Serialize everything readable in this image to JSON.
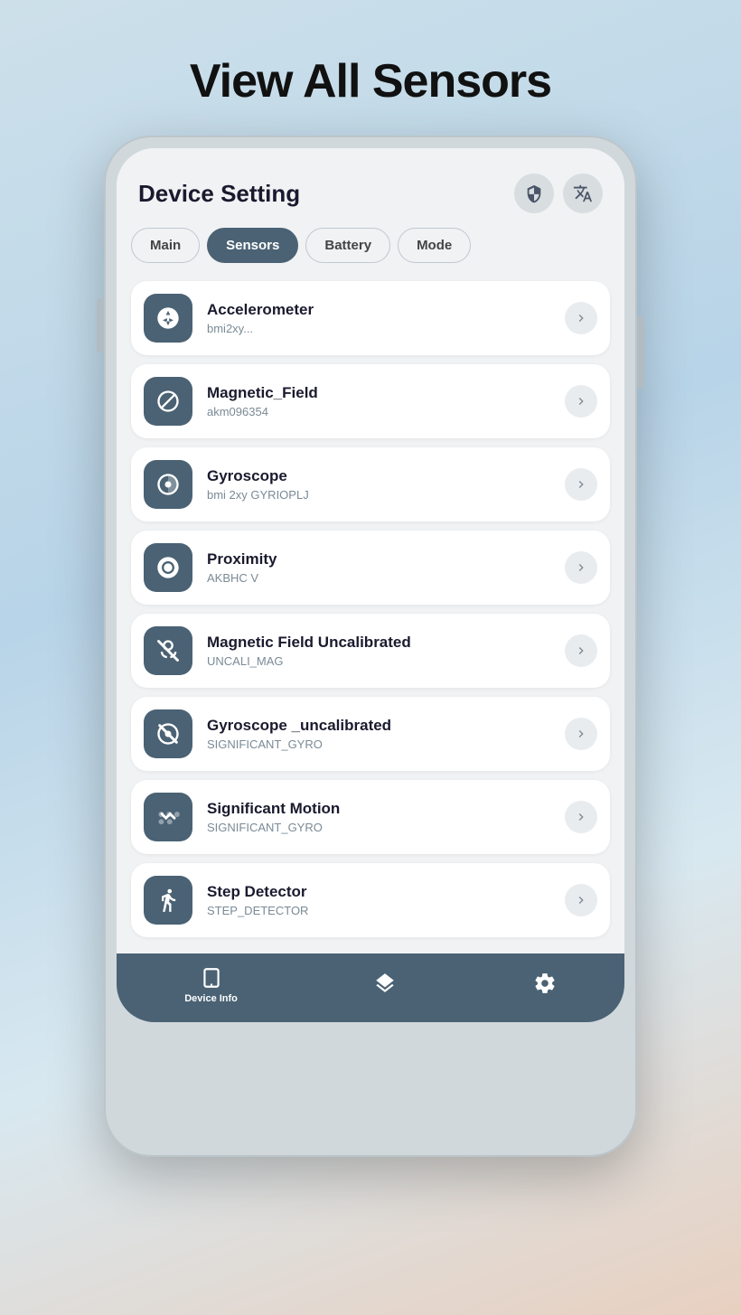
{
  "page": {
    "title": "View All Sensors"
  },
  "app": {
    "header_title": "Device Setting",
    "tabs": [
      {
        "label": "Main",
        "active": false
      },
      {
        "label": "Sensors",
        "active": true
      },
      {
        "label": "Battery",
        "active": false
      },
      {
        "label": "Mode",
        "active": false
      }
    ],
    "sensors": [
      {
        "name": "Accelerometer",
        "id": "bmi2xy...",
        "icon": "accelerometer"
      },
      {
        "name": "Magnetic_Field",
        "id": "akm096354",
        "icon": "magnetic"
      },
      {
        "name": "Gyroscope",
        "id": "bmi 2xy GYRIOPLJ",
        "icon": "gyroscope"
      },
      {
        "name": "Proximity",
        "id": "AKBHC V",
        "icon": "proximity"
      },
      {
        "name": "Magnetic Field Uncalibrated",
        "id": "UNCALI_MAG",
        "icon": "magnetic-uncal"
      },
      {
        "name": "Gyroscope _uncalibrated",
        "id": "SIGNIFICANT_GYRO",
        "icon": "gyroscope-uncal"
      },
      {
        "name": "Significant Motion",
        "id": "SIGNIFICANT_GYRO",
        "icon": "motion"
      },
      {
        "name": "Step Detector",
        "id": "STEP_DETECTOR",
        "icon": "step"
      }
    ],
    "bottom_nav": [
      {
        "label": "Device Info",
        "icon": "phone"
      },
      {
        "label": "",
        "icon": "layers"
      },
      {
        "label": "",
        "icon": "settings"
      }
    ]
  }
}
